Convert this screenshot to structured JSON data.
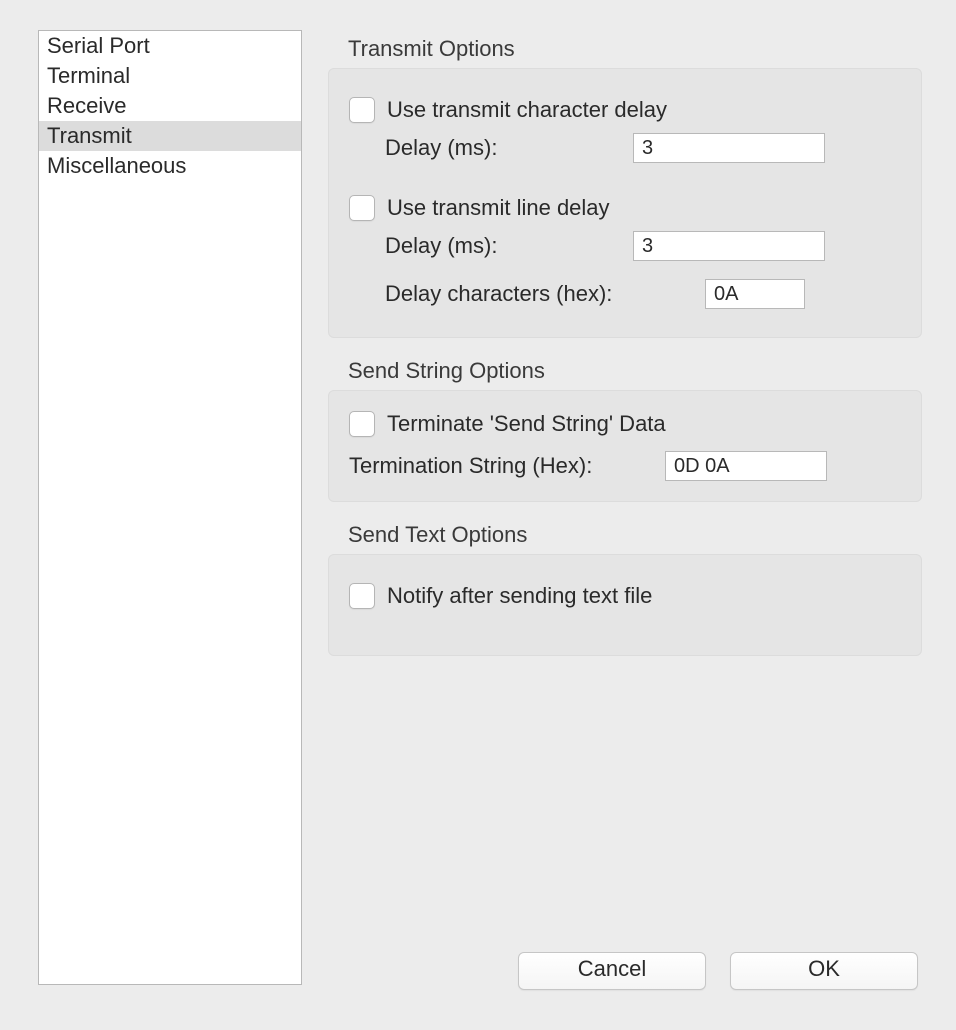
{
  "sidebar": {
    "items": [
      {
        "label": "Serial Port",
        "selected": false
      },
      {
        "label": "Terminal",
        "selected": false
      },
      {
        "label": "Receive",
        "selected": false
      },
      {
        "label": "Transmit",
        "selected": true
      },
      {
        "label": "Miscellaneous",
        "selected": false
      }
    ]
  },
  "sections": {
    "transmit": {
      "title": "Transmit Options",
      "char_delay": {
        "checkbox_label": "Use transmit character delay",
        "checked": false,
        "delay_label": "Delay (ms):",
        "delay_value": "3"
      },
      "line_delay": {
        "checkbox_label": "Use transmit line delay",
        "checked": false,
        "delay_label": "Delay (ms):",
        "delay_value": "3",
        "chars_label": "Delay characters (hex):",
        "chars_value": "0A"
      }
    },
    "send_string": {
      "title": "Send String Options",
      "terminate": {
        "checkbox_label": "Terminate 'Send String' Data",
        "checked": false
      },
      "termination_label": "Termination String (Hex):",
      "termination_value": "0D 0A"
    },
    "send_text": {
      "title": "Send Text Options",
      "notify": {
        "checkbox_label": "Notify after sending text file",
        "checked": false
      }
    }
  },
  "buttons": {
    "cancel": "Cancel",
    "ok": "OK"
  }
}
